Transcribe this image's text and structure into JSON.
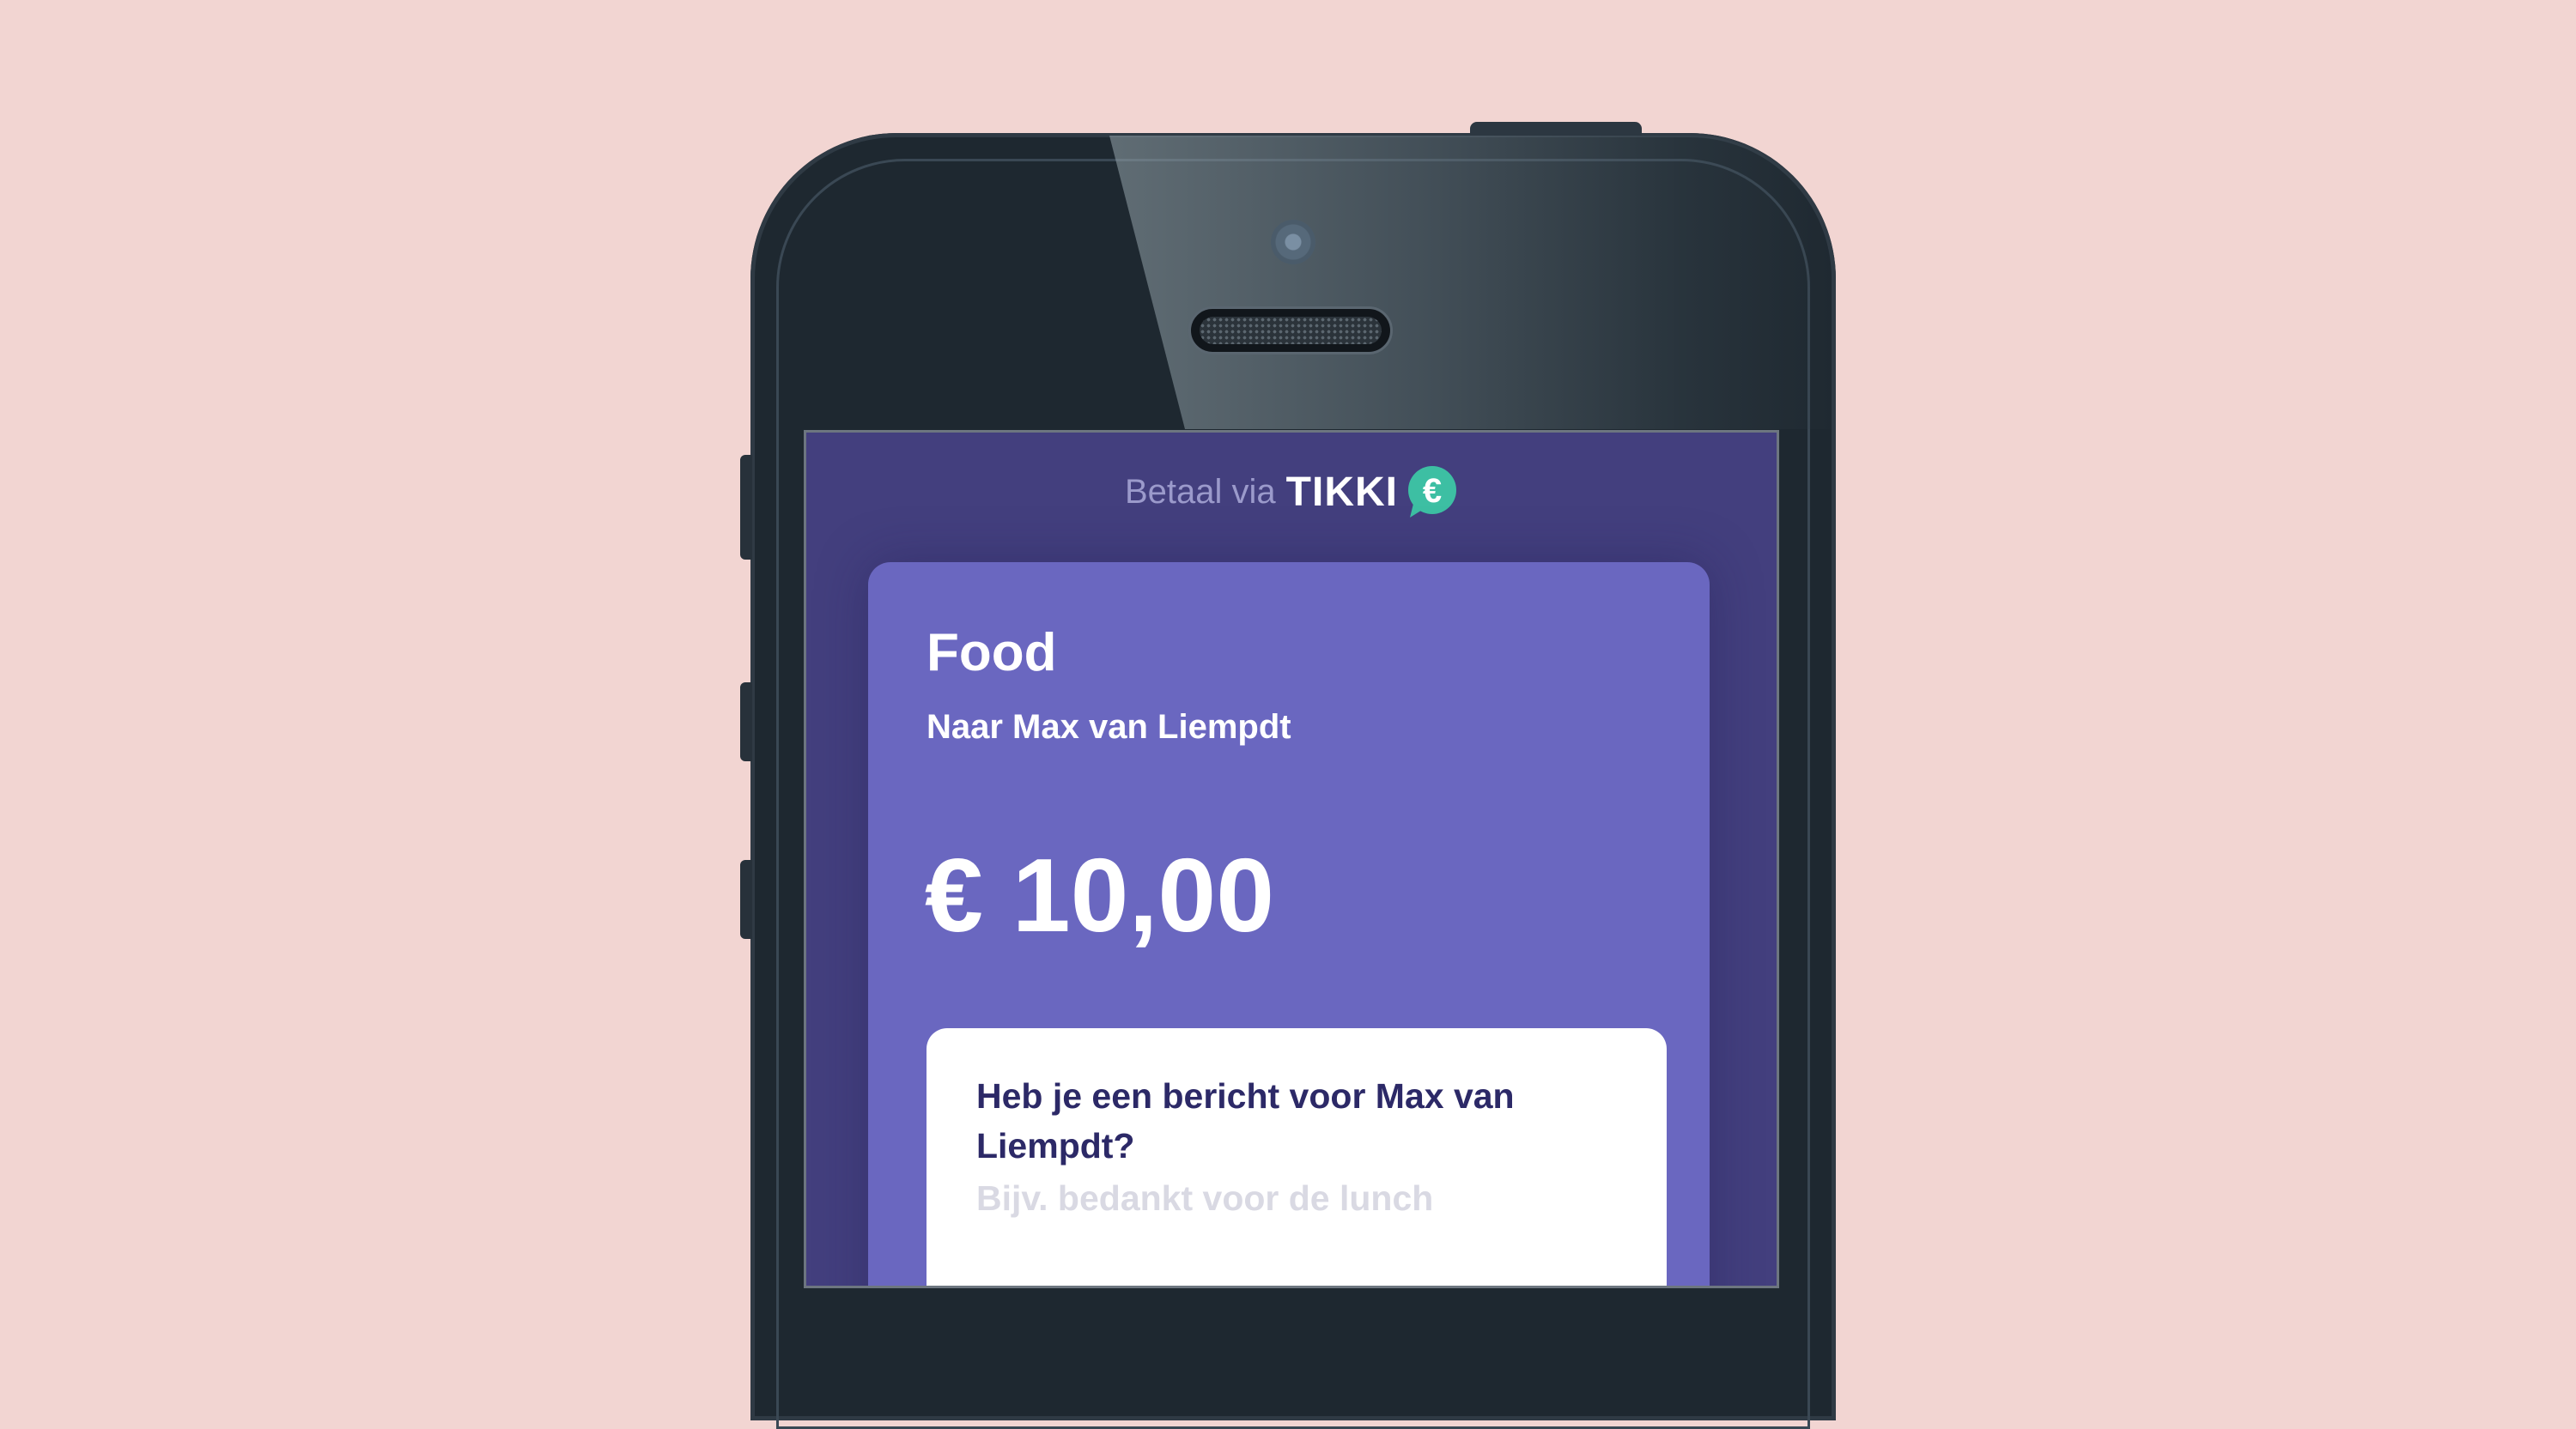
{
  "header": {
    "prefix": "Betaal via",
    "brand": "TIKKI",
    "brand_badge": "€"
  },
  "payment": {
    "title": "Food",
    "recipient": "Naar Max van Liempdt",
    "amount": "€ 10,00"
  },
  "message": {
    "question": "Heb je een bericht voor Max van Liempdt?",
    "placeholder": "Bijv. bedankt voor de lunch",
    "value": ""
  },
  "colors": {
    "background": "#f2d5d2",
    "screen": "#433f7e",
    "card": "#6a67c0",
    "brand_badge": "#3dbfa3",
    "question_text": "#2c2967"
  }
}
